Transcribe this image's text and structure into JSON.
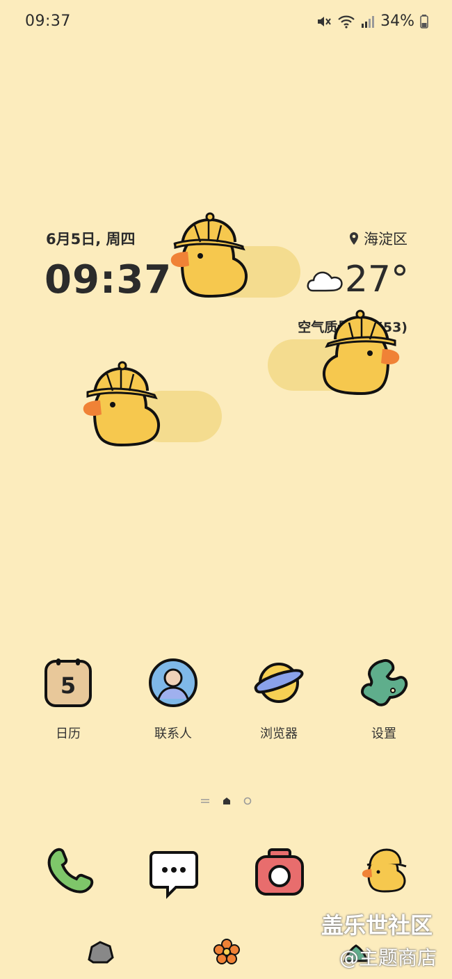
{
  "status_bar": {
    "time": "09:37",
    "battery_percent": "34%",
    "icons": [
      "mute-icon",
      "wifi-icon",
      "signal-icon",
      "battery-icon"
    ]
  },
  "widget": {
    "date": "6月5日, 周四",
    "clock": "09:37",
    "location": "海淀区",
    "temperature": "27°",
    "air_quality": "空气质量：良(53)"
  },
  "apps": [
    {
      "label": "日历",
      "icon": "calendar-icon",
      "day": "5"
    },
    {
      "label": "联系人",
      "icon": "contacts-icon"
    },
    {
      "label": "浏览器",
      "icon": "browser-planet-icon"
    },
    {
      "label": "设置",
      "icon": "settings-icon"
    }
  ],
  "dock": [
    "phone-icon",
    "messages-icon",
    "camera-icon",
    "duck-app-icon"
  ],
  "page_indicator": {
    "pages": 2,
    "current": 1
  },
  "bottom_icons": [
    "rock-icon",
    "flower-icon",
    "plant-icon"
  ],
  "watermark": {
    "line1": "盖乐世社区",
    "line2": "@主题商店"
  },
  "colors": {
    "background": "#fcecbd",
    "duck": "#f6c84e",
    "beak": "#f08236",
    "trail": "#f4dc8f"
  }
}
